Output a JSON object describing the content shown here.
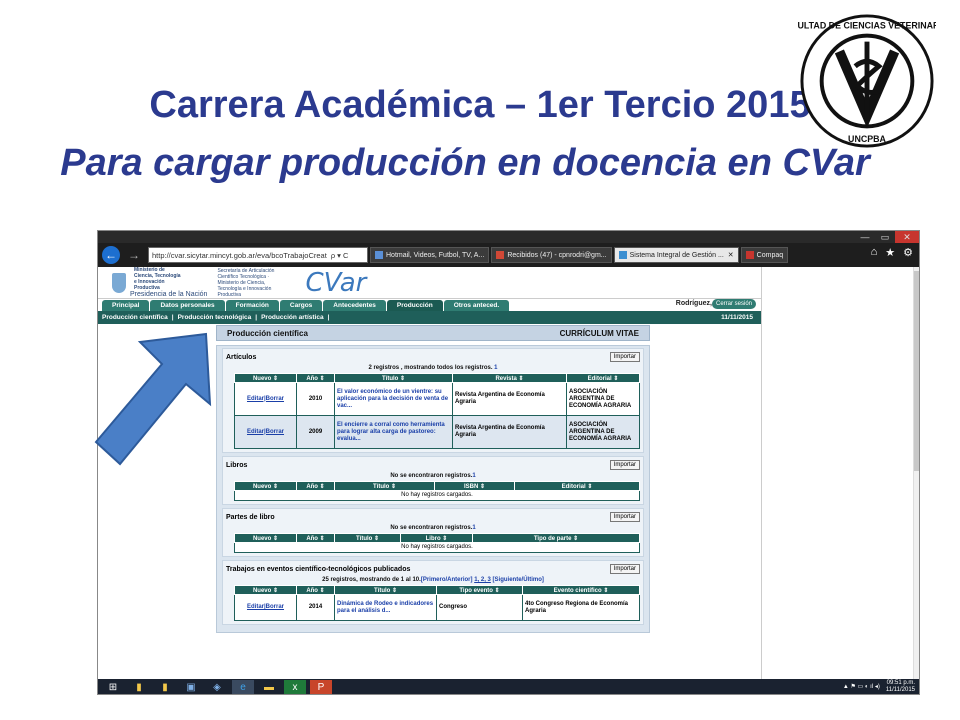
{
  "slide": {
    "title_line1": "Carrera Académica – 1er Tercio 2015",
    "title_line2": "Para cargar producción en docencia en CVar",
    "logo_text": "FACULTAD DE CIENCIAS VETERINARIAS · UNCPBA"
  },
  "browser": {
    "url": "http://cvar.sicytar.mincyt.gob.ar/eva/bcoTrabajoCreat",
    "url_icons": "ρ ▾ C",
    "tabs": [
      {
        "label": "Hotmail, Videos, Futbol, TV, A..."
      },
      {
        "label": "Recibidos (47) - cpnrodri@gm..."
      },
      {
        "label": "Sistema Integral de Gestión ..."
      },
      {
        "label": "Compaq"
      }
    ]
  },
  "site": {
    "ministerio": "Ministerio de Ciencia, Tecnología e Innovación Productiva",
    "presidencia": "Presidencia de la Nación",
    "secretaria": "Secretaría de Articulación Científico Tecnológica · Ministerio de Ciencia, Tecnología e Innovación Productiva",
    "brand": "CVar",
    "main_tabs": [
      "Principal",
      "Datos personales",
      "Formación",
      "Cargos",
      "Antecedentes",
      "Producción",
      "Otros anteced."
    ],
    "user": "Rodríguez, Gabriel",
    "logout": "Cerrar sesión",
    "sub_tabs": [
      "Producción científica",
      "|",
      "Producción tecnológica",
      "|",
      "Producción artística",
      "|"
    ],
    "date": "11/11/2015"
  },
  "section": {
    "title": "Producción científica",
    "right": "CURRÍCULUM VITAE"
  },
  "articulos": {
    "title": "Artículos",
    "import": "Importar",
    "msg": "2 registros , mostrando todos los registros.",
    "msg_link": "1",
    "headers": [
      "Nuevo",
      "Año",
      "Título",
      "Revista",
      "Editorial"
    ],
    "rows": [
      {
        "action": "Editar|Borrar",
        "year": "2010",
        "title": "El valor económico de un vientre: su aplicación para la decisión de venta de vac...",
        "journal": "Revista Argentina de Economía Agraria",
        "publisher": "ASOCIACIÓN ARGENTINA DE ECONOMÍA AGRARIA"
      },
      {
        "action": "Editar|Borrar",
        "year": "2009",
        "title": "El encierre a corral como herramienta para lograr alta carga de pastoreo: evalua...",
        "journal": "Revista Argentina de Economía Agraria",
        "publisher": "ASOCIACIÓN ARGENTINA DE ECONOMÍA AGRARIA"
      }
    ]
  },
  "libros": {
    "title": "Libros",
    "import": "Importar",
    "msg": "No se encontraron registros.",
    "msg_link": "1",
    "headers": [
      "Nuevo",
      "Año",
      "Título",
      "ISBN",
      "Editorial"
    ],
    "empty": "No hay registros cargados."
  },
  "partes": {
    "title": "Partes de libro",
    "import": "Importar",
    "msg": "No se encontraron registros.",
    "msg_link": "1",
    "headers": [
      "Nuevo",
      "Año",
      "Título",
      "Libro",
      "Tipo de parte"
    ],
    "empty": "No hay registros cargados."
  },
  "eventos": {
    "title": "Trabajos en eventos científico-tecnológicos publicados",
    "import": "Importar",
    "msg": "25 registros, mostrando de 1 al 10.",
    "pager": "[Primero/Anterior]",
    "pages": "1, 2, 3",
    "pager_next": "[Siguiente/Último]",
    "headers": [
      "Nuevo",
      "Año",
      "Título",
      "Tipo evento",
      "Evento científico"
    ],
    "rows": [
      {
        "action": "Editar|Borrar",
        "year": "2014",
        "title": "Dinámica de Rodeo e indicadores para el análisis d...",
        "type": "Congreso",
        "event": "4to Congreso Regiona de Economía Agraria"
      }
    ]
  },
  "taskbar": {
    "time": "09:51 p.m.",
    "date": "11/11/2015"
  },
  "colors": {
    "title": "#2b3a8f",
    "teal": "#1f5f5a",
    "arrow": "#4a7fc7"
  }
}
